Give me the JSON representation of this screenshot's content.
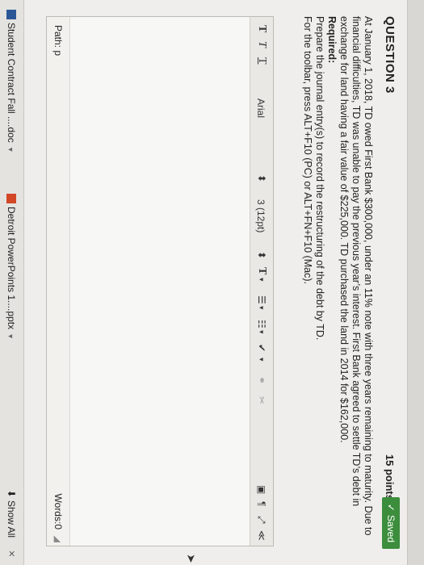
{
  "question": {
    "title": "QUESTION 3",
    "points": "15 points",
    "saved_label": "Saved",
    "body": "At January 1, 2018, TD owed First Bank $300,000, under an 11% note with three years remaining to maturity. Due to financial difficulties, TD was unable to pay the previous year’s interest. First Bank agreed to settle TD’s debt in exchange for land having a fair value of $225,000. TD purchased the land in 2014 for $162,000.",
    "required_label": "Required:",
    "instruction": "Prepare the journal entry(s) to record the restructuring of the debt by TD.",
    "toolbar_hint": "For the toolbar, press ALT+F10 (PC) or ALT+FN+F10 (Mac)."
  },
  "editor": {
    "bold": "T",
    "italic": "T",
    "underline": "T",
    "font_family": "Arial",
    "font_size": "3 (12pt)",
    "text_color": "T",
    "path_label": "Path: p",
    "words_label": "Words:0",
    "colors": {
      "swatch": "#6b6b6b"
    }
  },
  "downloads": {
    "items": [
      {
        "label": "Student Contract Fall ....doc"
      },
      {
        "label": "Detroit PowerPoints 1....pptx"
      }
    ],
    "show_all": "Show All",
    "close": "×"
  },
  "colors": {
    "saved_bg": "#3c8d3c",
    "background": "#efeeec"
  }
}
